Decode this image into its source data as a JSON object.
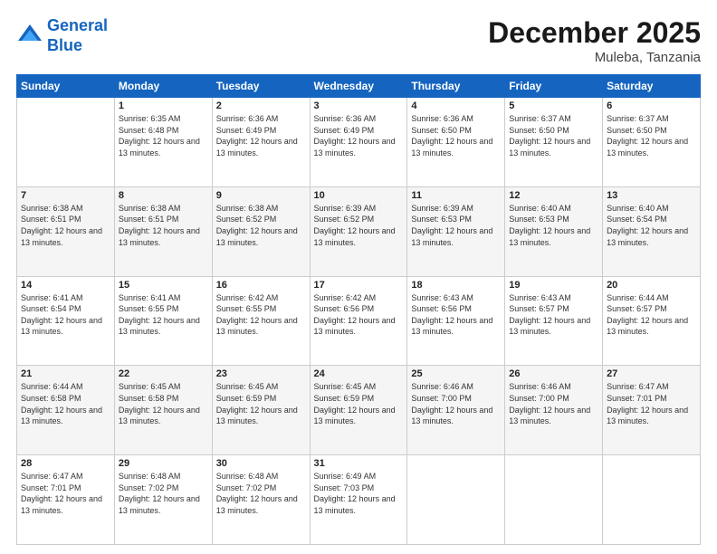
{
  "header": {
    "logo_line1": "General",
    "logo_line2": "Blue",
    "month": "December 2025",
    "location": "Muleba, Tanzania"
  },
  "weekdays": [
    "Sunday",
    "Monday",
    "Tuesday",
    "Wednesday",
    "Thursday",
    "Friday",
    "Saturday"
  ],
  "weeks": [
    [
      {
        "day": "",
        "sunrise": "",
        "sunset": "",
        "daylight": ""
      },
      {
        "day": "1",
        "sunrise": "Sunrise: 6:35 AM",
        "sunset": "Sunset: 6:48 PM",
        "daylight": "Daylight: 12 hours and 13 minutes."
      },
      {
        "day": "2",
        "sunrise": "Sunrise: 6:36 AM",
        "sunset": "Sunset: 6:49 PM",
        "daylight": "Daylight: 12 hours and 13 minutes."
      },
      {
        "day": "3",
        "sunrise": "Sunrise: 6:36 AM",
        "sunset": "Sunset: 6:49 PM",
        "daylight": "Daylight: 12 hours and 13 minutes."
      },
      {
        "day": "4",
        "sunrise": "Sunrise: 6:36 AM",
        "sunset": "Sunset: 6:50 PM",
        "daylight": "Daylight: 12 hours and 13 minutes."
      },
      {
        "day": "5",
        "sunrise": "Sunrise: 6:37 AM",
        "sunset": "Sunset: 6:50 PM",
        "daylight": "Daylight: 12 hours and 13 minutes."
      },
      {
        "day": "6",
        "sunrise": "Sunrise: 6:37 AM",
        "sunset": "Sunset: 6:50 PM",
        "daylight": "Daylight: 12 hours and 13 minutes."
      }
    ],
    [
      {
        "day": "7",
        "sunrise": "Sunrise: 6:38 AM",
        "sunset": "Sunset: 6:51 PM",
        "daylight": "Daylight: 12 hours and 13 minutes."
      },
      {
        "day": "8",
        "sunrise": "Sunrise: 6:38 AM",
        "sunset": "Sunset: 6:51 PM",
        "daylight": "Daylight: 12 hours and 13 minutes."
      },
      {
        "day": "9",
        "sunrise": "Sunrise: 6:38 AM",
        "sunset": "Sunset: 6:52 PM",
        "daylight": "Daylight: 12 hours and 13 minutes."
      },
      {
        "day": "10",
        "sunrise": "Sunrise: 6:39 AM",
        "sunset": "Sunset: 6:52 PM",
        "daylight": "Daylight: 12 hours and 13 minutes."
      },
      {
        "day": "11",
        "sunrise": "Sunrise: 6:39 AM",
        "sunset": "Sunset: 6:53 PM",
        "daylight": "Daylight: 12 hours and 13 minutes."
      },
      {
        "day": "12",
        "sunrise": "Sunrise: 6:40 AM",
        "sunset": "Sunset: 6:53 PM",
        "daylight": "Daylight: 12 hours and 13 minutes."
      },
      {
        "day": "13",
        "sunrise": "Sunrise: 6:40 AM",
        "sunset": "Sunset: 6:54 PM",
        "daylight": "Daylight: 12 hours and 13 minutes."
      }
    ],
    [
      {
        "day": "14",
        "sunrise": "Sunrise: 6:41 AM",
        "sunset": "Sunset: 6:54 PM",
        "daylight": "Daylight: 12 hours and 13 minutes."
      },
      {
        "day": "15",
        "sunrise": "Sunrise: 6:41 AM",
        "sunset": "Sunset: 6:55 PM",
        "daylight": "Daylight: 12 hours and 13 minutes."
      },
      {
        "day": "16",
        "sunrise": "Sunrise: 6:42 AM",
        "sunset": "Sunset: 6:55 PM",
        "daylight": "Daylight: 12 hours and 13 minutes."
      },
      {
        "day": "17",
        "sunrise": "Sunrise: 6:42 AM",
        "sunset": "Sunset: 6:56 PM",
        "daylight": "Daylight: 12 hours and 13 minutes."
      },
      {
        "day": "18",
        "sunrise": "Sunrise: 6:43 AM",
        "sunset": "Sunset: 6:56 PM",
        "daylight": "Daylight: 12 hours and 13 minutes."
      },
      {
        "day": "19",
        "sunrise": "Sunrise: 6:43 AM",
        "sunset": "Sunset: 6:57 PM",
        "daylight": "Daylight: 12 hours and 13 minutes."
      },
      {
        "day": "20",
        "sunrise": "Sunrise: 6:44 AM",
        "sunset": "Sunset: 6:57 PM",
        "daylight": "Daylight: 12 hours and 13 minutes."
      }
    ],
    [
      {
        "day": "21",
        "sunrise": "Sunrise: 6:44 AM",
        "sunset": "Sunset: 6:58 PM",
        "daylight": "Daylight: 12 hours and 13 minutes."
      },
      {
        "day": "22",
        "sunrise": "Sunrise: 6:45 AM",
        "sunset": "Sunset: 6:58 PM",
        "daylight": "Daylight: 12 hours and 13 minutes."
      },
      {
        "day": "23",
        "sunrise": "Sunrise: 6:45 AM",
        "sunset": "Sunset: 6:59 PM",
        "daylight": "Daylight: 12 hours and 13 minutes."
      },
      {
        "day": "24",
        "sunrise": "Sunrise: 6:45 AM",
        "sunset": "Sunset: 6:59 PM",
        "daylight": "Daylight: 12 hours and 13 minutes."
      },
      {
        "day": "25",
        "sunrise": "Sunrise: 6:46 AM",
        "sunset": "Sunset: 7:00 PM",
        "daylight": "Daylight: 12 hours and 13 minutes."
      },
      {
        "day": "26",
        "sunrise": "Sunrise: 6:46 AM",
        "sunset": "Sunset: 7:00 PM",
        "daylight": "Daylight: 12 hours and 13 minutes."
      },
      {
        "day": "27",
        "sunrise": "Sunrise: 6:47 AM",
        "sunset": "Sunset: 7:01 PM",
        "daylight": "Daylight: 12 hours and 13 minutes."
      }
    ],
    [
      {
        "day": "28",
        "sunrise": "Sunrise: 6:47 AM",
        "sunset": "Sunset: 7:01 PM",
        "daylight": "Daylight: 12 hours and 13 minutes."
      },
      {
        "day": "29",
        "sunrise": "Sunrise: 6:48 AM",
        "sunset": "Sunset: 7:02 PM",
        "daylight": "Daylight: 12 hours and 13 minutes."
      },
      {
        "day": "30",
        "sunrise": "Sunrise: 6:48 AM",
        "sunset": "Sunset: 7:02 PM",
        "daylight": "Daylight: 12 hours and 13 minutes."
      },
      {
        "day": "31",
        "sunrise": "Sunrise: 6:49 AM",
        "sunset": "Sunset: 7:03 PM",
        "daylight": "Daylight: 12 hours and 13 minutes."
      },
      {
        "day": "",
        "sunrise": "",
        "sunset": "",
        "daylight": ""
      },
      {
        "day": "",
        "sunrise": "",
        "sunset": "",
        "daylight": ""
      },
      {
        "day": "",
        "sunrise": "",
        "sunset": "",
        "daylight": ""
      }
    ]
  ]
}
